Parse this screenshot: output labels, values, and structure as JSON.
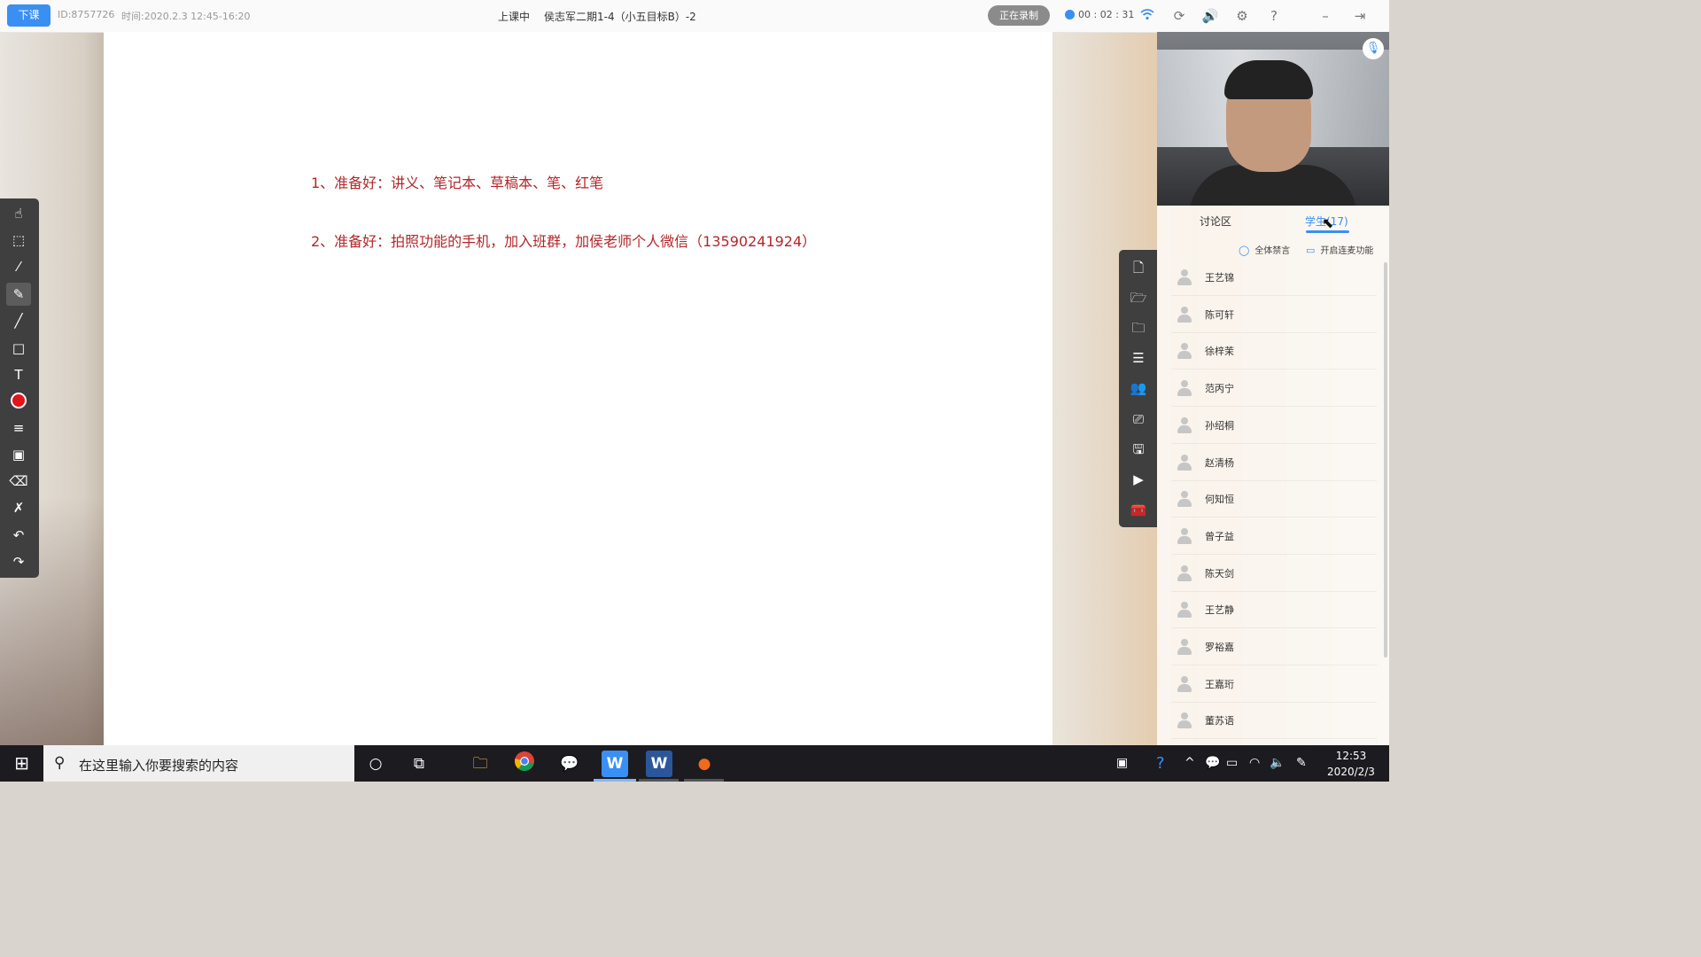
{
  "topbar": {
    "end_class_label": "下课",
    "room_id": "ID:8757726",
    "time_range": "时间:2020.2.3 12:45-16:20",
    "status": "上课中",
    "course_title": "侯志军二期1-4（小五目标B）-2",
    "recording_label": "正在录制",
    "elapsed": "00 : 02 : 31"
  },
  "whiteboard": {
    "notes": [
      "1、准备好：讲义、笔记本、草稿本、笔、红笔",
      "2、准备好：拍照功能的手机，加入班群，加侯老师个人微信（13590241924）"
    ]
  },
  "panel": {
    "tab_discussion": "讨论区",
    "tab_students": "学生(17)",
    "mute_all": "全体禁言",
    "enable_mic": "开启连麦功能",
    "students": [
      "王艺锦",
      "陈可轩",
      "徐梓茉",
      "范丙宁",
      "孙绍桐",
      "赵清杨",
      "何知恒",
      "曾子益",
      "陈天剑",
      "王艺静",
      "罗裕嘉",
      "王嘉珩",
      "董苏语"
    ]
  },
  "taskbar": {
    "search_placeholder": "在这里输入你要搜索的内容",
    "time": "12:53",
    "date": "2020/2/3"
  },
  "colors": {
    "accent": "#3a8ff3",
    "note_text": "#b3262a",
    "toolbar_bg": "#3f3f3f",
    "pen_color": "#e0161d"
  },
  "icons": {
    "left_tools": [
      "hand-icon",
      "select-icon",
      "laser-pointer-icon",
      "pen-icon",
      "line-icon",
      "rectangle-icon",
      "text-icon",
      "color-icon",
      "line-width-icon",
      "image-icon",
      "eraser-icon",
      "clear-icon",
      "undo-icon",
      "redo-icon"
    ],
    "side_tools": [
      "add-page-icon",
      "open-folder-icon",
      "courseware-icon",
      "list-icon",
      "users-icon",
      "screen-share-icon",
      "save-icon",
      "play-icon",
      "toolbox-icon"
    ]
  }
}
